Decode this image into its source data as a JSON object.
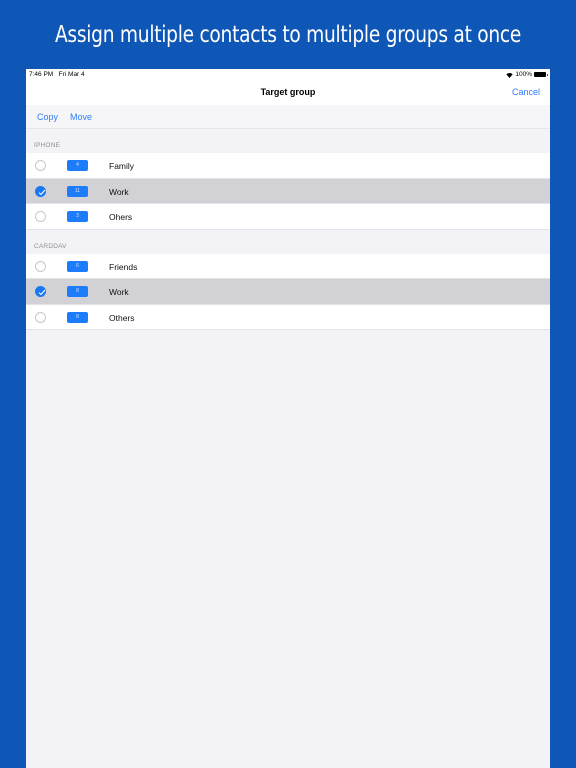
{
  "headline": "Assign multiple contacts to multiple groups at once",
  "colors": {
    "background": "#0f57b6",
    "accent": "#2f7cf6",
    "badge": "#1c7cf9",
    "selected_row": "#d1d1d6"
  },
  "statusbar": {
    "time": "7:46 PM",
    "date": "Fri Mar 4",
    "battery": "100%",
    "wifi_icon": "wifi-icon",
    "battery_icon": "battery-icon"
  },
  "navbar": {
    "title": "Target group",
    "cancel_label": "Cancel"
  },
  "toolbar": {
    "copy_label": "Copy",
    "move_label": "Move"
  },
  "sections": [
    {
      "header": "IPHONE",
      "rows": [
        {
          "count": "4",
          "name": "Family",
          "selected": false
        },
        {
          "count": "11",
          "name": "Work",
          "selected": true
        },
        {
          "count": "3",
          "name": "Ohers",
          "selected": false
        }
      ]
    },
    {
      "header": "CARDDAV",
      "rows": [
        {
          "count": "6",
          "name": "Friends",
          "selected": false
        },
        {
          "count": "8",
          "name": "Work",
          "selected": true
        },
        {
          "count": "8",
          "name": "Others",
          "selected": false
        }
      ]
    }
  ]
}
